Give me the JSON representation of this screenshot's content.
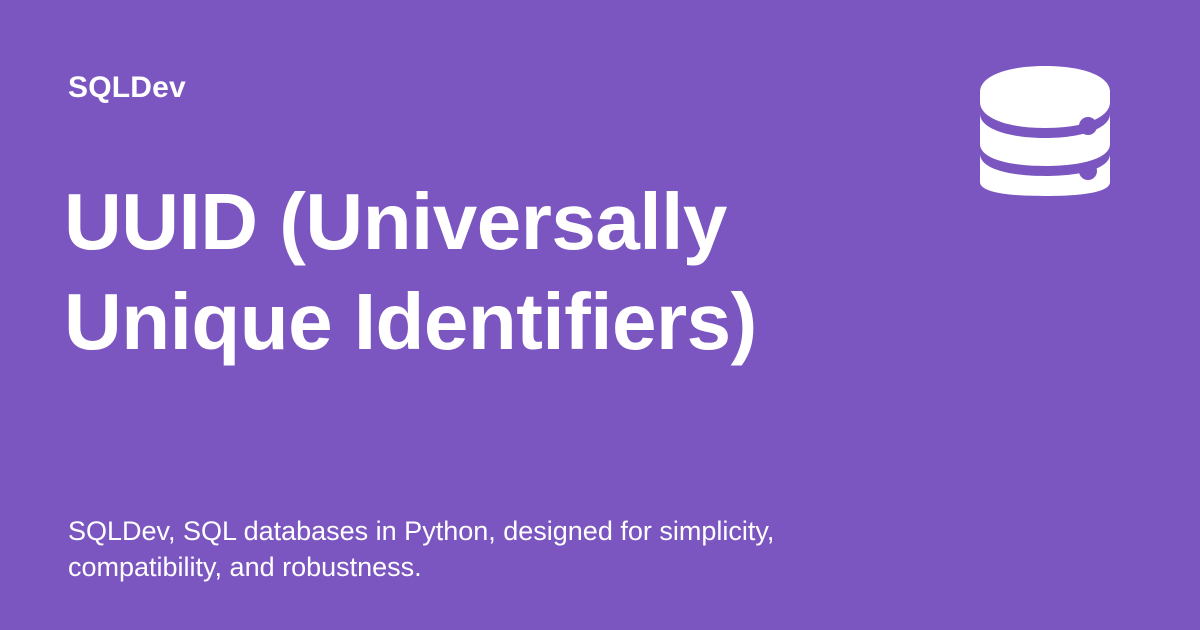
{
  "brand": {
    "name": "SQLDev"
  },
  "page": {
    "title": "UUID (Universally Unique Identifiers)",
    "description": "SQLDev, SQL databases in Python, designed for simplicity, compatibility, and robustness."
  },
  "icon": {
    "name": "database-icon"
  },
  "colors": {
    "background": "#7b56c0",
    "foreground": "#ffffff"
  }
}
